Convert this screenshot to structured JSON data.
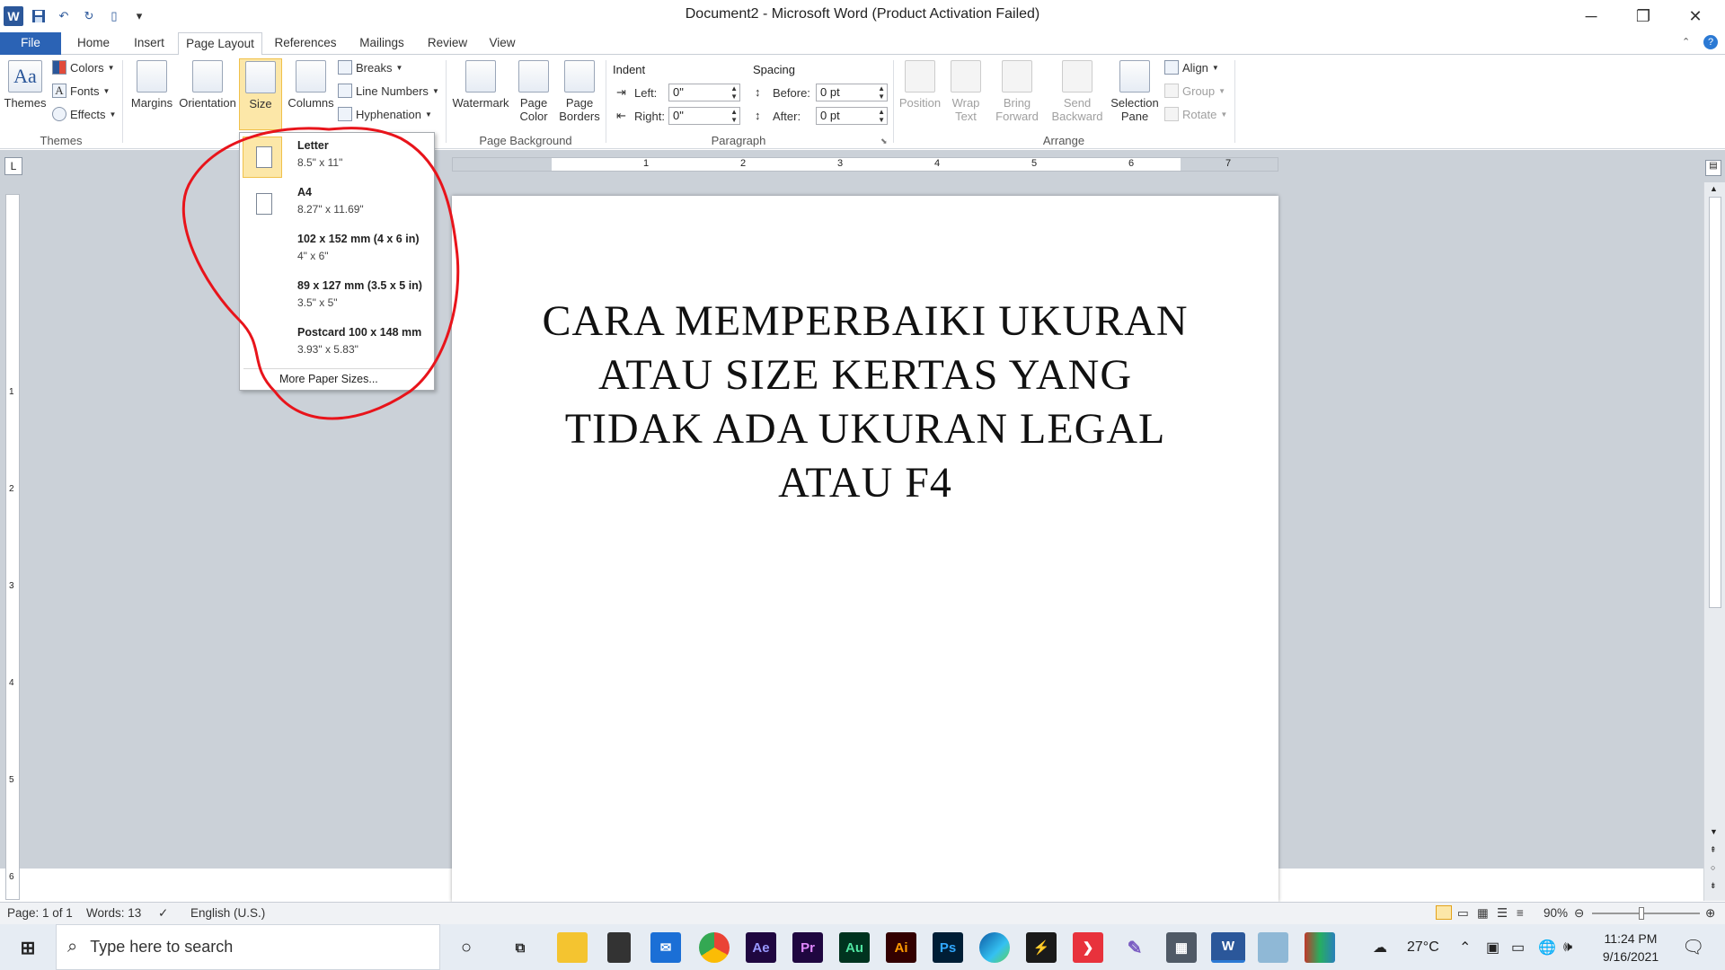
{
  "window": {
    "title": "Document2  -  Microsoft Word (Product Activation Failed)",
    "minimize": "─",
    "restore": "❐",
    "close": "✕"
  },
  "qat": {
    "logo": "W",
    "save": "💾",
    "undo": "↶",
    "redo": "↻",
    "new": "▯",
    "customize": "▾"
  },
  "tabs": [
    {
      "label": "File"
    },
    {
      "label": "Home"
    },
    {
      "label": "Insert"
    },
    {
      "label": "Page Layout"
    },
    {
      "label": "References"
    },
    {
      "label": "Mailings"
    },
    {
      "label": "Review"
    },
    {
      "label": "View"
    }
  ],
  "ribbon": {
    "themes": {
      "themes": "Themes",
      "colors": "Colors",
      "fonts": "Fonts",
      "effects": "Effects",
      "group": "Themes"
    },
    "page_setup": {
      "margins": "Margins",
      "orientation": "Orientation",
      "size": "Size",
      "columns": "Columns",
      "breaks": "Breaks",
      "line_numbers": "Line Numbers",
      "hyphenation": "Hyphenation"
    },
    "page_background": {
      "watermark": "Watermark",
      "page_color_1": "Page",
      "page_color_2": "Color",
      "page_borders_1": "Page",
      "page_borders_2": "Borders",
      "group": "Page Background"
    },
    "paragraph": {
      "indent": "Indent",
      "spacing": "Spacing",
      "left_label": "Left:",
      "left_value": "0\"",
      "right_label": "Right:",
      "right_value": "0\"",
      "before_label": "Before:",
      "before_value": "0 pt",
      "after_label": "After:",
      "after_value": "0 pt",
      "group": "Paragraph"
    },
    "arrange": {
      "position": "Position",
      "wrap_1": "Wrap",
      "wrap_2": "Text",
      "bring_1": "Bring",
      "bring_2": "Forward",
      "send_1": "Send",
      "send_2": "Backward",
      "selection_1": "Selection",
      "selection_2": "Pane",
      "align": "Align",
      "group_btn": "Group",
      "rotate": "Rotate",
      "group": "Arrange"
    }
  },
  "size_menu": {
    "items": [
      {
        "name": "Letter",
        "dims": "8.5\" x 11\""
      },
      {
        "name": "A4",
        "dims": "8.27\" x 11.69\""
      },
      {
        "name": "102 x 152 mm (4 x 6 in)",
        "dims": "4\" x 6\""
      },
      {
        "name": "89 x 127 mm (3.5 x 5 in)",
        "dims": "3.5\" x 5\""
      },
      {
        "name": "Postcard 100 x 148 mm",
        "dims": "3.93\" x 5.83\""
      }
    ],
    "more": "More Paper Sizes..."
  },
  "ruler": {
    "h_ticks": [
      "1",
      "2",
      "3",
      "4",
      "5",
      "6",
      "7"
    ],
    "v_ticks": [
      "1",
      "2",
      "3",
      "4",
      "5",
      "6"
    ],
    "tab_button": "L"
  },
  "document": {
    "lines": [
      "CARA MEMPERBAIKI UKURAN",
      "ATAU SIZE KERTAS YANG",
      "TIDAK ADA UKURAN LEGAL",
      "ATAU F4"
    ]
  },
  "status": {
    "page": "Page: 1 of 1",
    "words": "Words: 13",
    "language": "English (U.S.)",
    "zoom": "90%"
  },
  "taskbar": {
    "search_placeholder": "Type here to search",
    "apps": [
      "Ae",
      "Pr",
      "Au",
      "Ai",
      "Ps",
      "W"
    ],
    "weather": "27°C",
    "time": "11:24 PM",
    "date": "9/16/2021"
  },
  "colors": {
    "accent": "#2b579a",
    "file_tab": "#2b63b5",
    "highlight": "#fce7a8",
    "annotation": "#e8141b"
  }
}
